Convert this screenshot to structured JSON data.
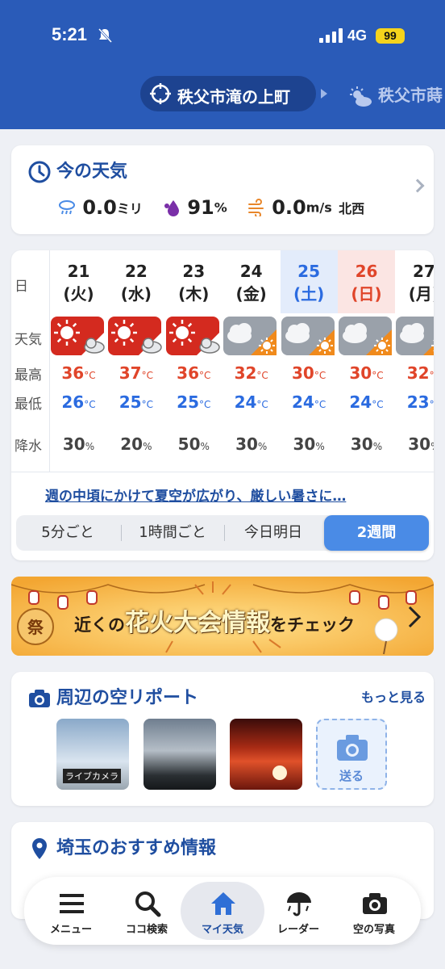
{
  "status": {
    "time": "5:21",
    "network": "4G",
    "battery": "99"
  },
  "location": {
    "current": "秩父市滝の上町",
    "next": "秩父市蒔"
  },
  "current_weather": {
    "title": "今の天気",
    "precip_value": "0.0",
    "precip_unit": "ミリ",
    "humidity_value": "91",
    "humidity_unit": "%",
    "wind_value": "0.0",
    "wind_unit": "m/s",
    "wind_dir": "北西"
  },
  "forecast": {
    "row_labels": {
      "day": "日",
      "weather": "天気",
      "high": "最高",
      "low": "最低",
      "rain": "降水"
    },
    "temp_unit": "°C",
    "rain_unit": "%",
    "days": [
      {
        "date": "21",
        "dow": "(火)",
        "icon": "sunny-then-cloudy-icon",
        "high": "36",
        "low": "26",
        "rain": "30"
      },
      {
        "date": "22",
        "dow": "(水)",
        "icon": "sunny-then-cloudy-icon",
        "high": "37",
        "low": "25",
        "rain": "20"
      },
      {
        "date": "23",
        "dow": "(木)",
        "icon": "sunny-then-cloudy-icon",
        "high": "36",
        "low": "25",
        "rain": "50"
      },
      {
        "date": "24",
        "dow": "(金)",
        "icon": "cloudy-then-sunny-icon",
        "high": "32",
        "low": "24",
        "rain": "30"
      },
      {
        "date": "25",
        "dow": "(土)",
        "icon": "cloudy-then-sunny-icon",
        "high": "30",
        "low": "24",
        "rain": "30"
      },
      {
        "date": "26",
        "dow": "(日)",
        "icon": "cloudy-then-sunny-icon",
        "high": "30",
        "low": "24",
        "rain": "30"
      },
      {
        "date": "27",
        "dow": "(月)",
        "icon": "cloudy-then-sunny-icon",
        "high": "32",
        "low": "23",
        "rain": "30"
      }
    ],
    "comment": "週の中頃にかけて夏空が広がり、厳しい暑さに…",
    "tabs": [
      "5分ごと",
      "1時間ごと",
      "今日明日",
      "2週間"
    ],
    "active_tab": "2週間"
  },
  "banner": {
    "pre": "近くの",
    "big": "花火大会情報",
    "post": "をチェック"
  },
  "sky_report": {
    "title": "周辺の空リポート",
    "more": "もっと見る",
    "live_label": "ライブカメラ",
    "send_label": "送る"
  },
  "recommend": {
    "title": "埼玉のおすすめ情報"
  },
  "tabbar": [
    "メニュー",
    "ココ検索",
    "マイ天気",
    "レーダー",
    "空の写真"
  ],
  "colors": {
    "header": "#2a5bb8",
    "accent": "#1f4ea0",
    "high": "#e0452a",
    "low": "#2b6be0",
    "saturday": "#2b6be0",
    "sunday": "#e0452a"
  }
}
